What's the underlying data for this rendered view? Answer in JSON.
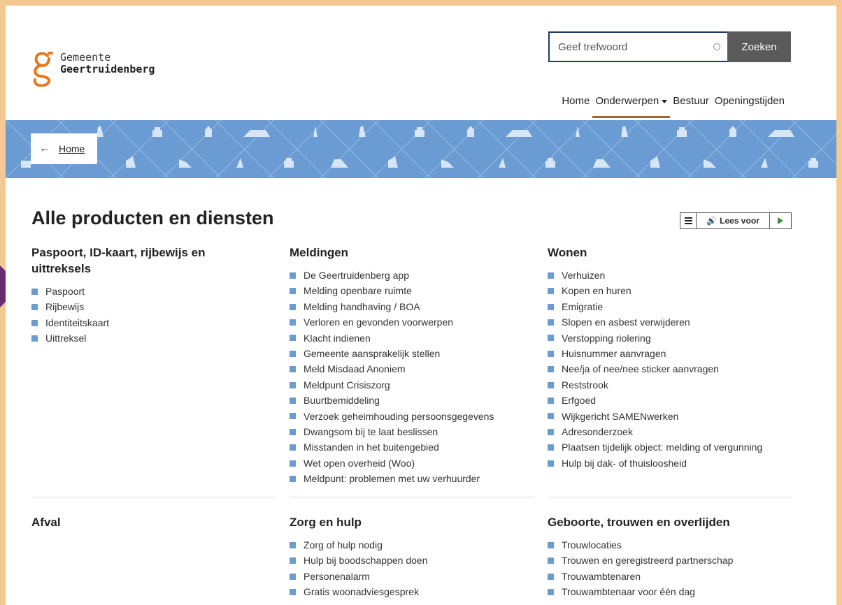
{
  "logo": {
    "line1": "Gemeente",
    "line2": "Geertruidenberg",
    "color": "#e8761e"
  },
  "search": {
    "placeholder": "Geef trefwoord",
    "button": "Zoeken"
  },
  "nav": [
    {
      "label": "Home",
      "active": false
    },
    {
      "label": "Onderwerpen",
      "active": true,
      "dropdown": true
    },
    {
      "label": "Bestuur",
      "active": false
    },
    {
      "label": "Openingstijden",
      "active": false
    }
  ],
  "breadcrumb": {
    "label": "Home"
  },
  "page_title": "Alle producten en diensten",
  "read_aloud": {
    "label": "Lees voor"
  },
  "sections": [
    {
      "title": "Paspoort, ID-kaart, rijbewijs en uittreksels",
      "items": [
        "Paspoort",
        "Rijbewijs",
        "Identiteitskaart",
        "Uittreksel"
      ]
    },
    {
      "title": "Meldingen",
      "items": [
        "De Geertruidenberg app",
        "Melding openbare ruimte",
        "Melding handhaving / BOA",
        "Verloren en gevonden voorwerpen",
        "Klacht indienen",
        "Gemeente aansprakelijk stellen",
        "Meld Misdaad Anoniem",
        "Meldpunt Crisiszorg",
        "Buurtbemiddeling",
        "Verzoek geheimhouding persoonsgegevens",
        "Dwangsom bij te laat beslissen",
        "Misstanden in het buitengebied",
        "Wet open overheid (Woo)",
        "Meldpunt: problemen met uw verhuurder"
      ]
    },
    {
      "title": "Wonen",
      "items": [
        "Verhuizen",
        "Kopen en huren",
        "Emigratie",
        "Slopen en asbest verwijderen",
        "Verstopping riolering",
        "Huisnummer aanvragen",
        "Nee/ja of nee/nee sticker aanvragen",
        "Reststrook",
        "Erfgoed",
        "Wijkgericht SAMENwerken",
        "Adresonderzoek",
        "Plaatsen tijdelijk object: melding of vergunning",
        "Hulp bij dak- of thuisloosheid"
      ]
    },
    {
      "title": "Afval",
      "items": []
    },
    {
      "title": "Zorg en hulp",
      "items": [
        "Zorg of hulp nodig",
        "Hulp bij boodschappen doen",
        "Personenalarm",
        "Gratis woonadviesgesprek"
      ]
    },
    {
      "title": "Geboorte, trouwen en overlijden",
      "items": [
        "Trouwlocaties",
        "Trouwen en geregistreerd partnerschap",
        "Trouwambtenaren",
        "Trouwambtenaar voor één dag"
      ]
    }
  ],
  "colors": {
    "accent_blue": "#6a9bd2",
    "nav_underline": "#a9642a",
    "frame": "#f6c892"
  }
}
